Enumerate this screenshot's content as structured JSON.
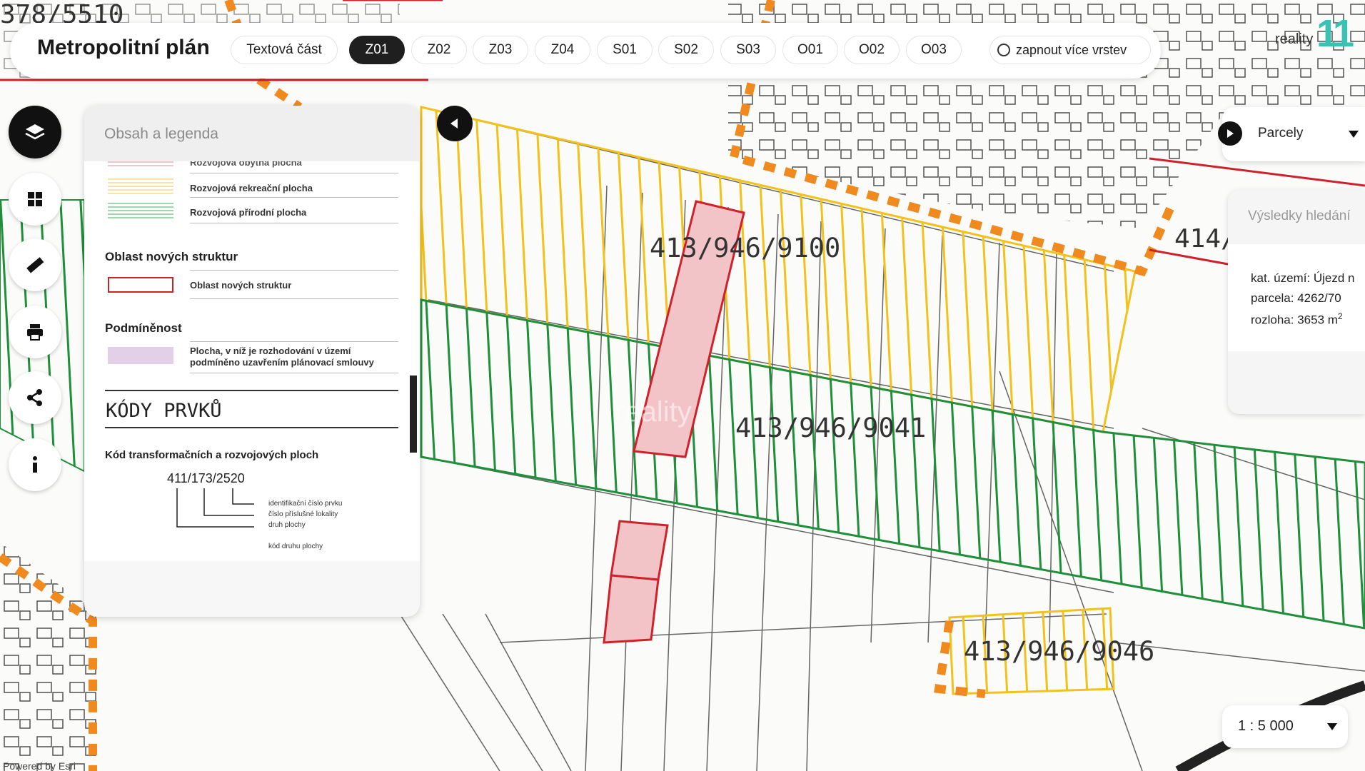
{
  "app": {
    "title": "Metropolitní plán"
  },
  "tabs": [
    {
      "label": "Textová část",
      "active": false
    },
    {
      "label": "Z01",
      "active": true
    },
    {
      "label": "Z02",
      "active": false
    },
    {
      "label": "Z03",
      "active": false
    },
    {
      "label": "Z04",
      "active": false
    },
    {
      "label": "S01",
      "active": false
    },
    {
      "label": "S02",
      "active": false
    },
    {
      "label": "S03",
      "active": false
    },
    {
      "label": "O01",
      "active": false
    },
    {
      "label": "O02",
      "active": false
    },
    {
      "label": "O03",
      "active": false
    }
  ],
  "layers_toggle": {
    "label": "zapnout více vrstev"
  },
  "brand": {
    "text": "reality",
    "mark": "11"
  },
  "tools": [
    "layers-icon",
    "grid-icon",
    "ruler-icon",
    "print-icon",
    "share-icon",
    "info-icon"
  ],
  "legend": {
    "title": "Obsah a legenda",
    "top_cut_item": "Rozvojová obytná plocha",
    "items_top": [
      "Rozvojová rekreační plocha",
      "Rozvojová přírodní plocha"
    ],
    "section_nove": "Oblast nových struktur",
    "item_nove": "Oblast nových struktur",
    "section_podm": "Podmíněnost",
    "item_podm_1": "Plocha, v níž je rozhodování v území",
    "item_podm_2": "podmíněno uzavřením plánovací smlouvy",
    "heading_kody": "KÓDY PRVKŮ",
    "kod_section": "Kód transformačních a rozvojových ploch",
    "kod_example": "411/173/2520",
    "kod_desc": [
      "identifikační číslo prvku",
      "číslo příslušné lokality",
      "druh plochy",
      "kód druhu plochy"
    ]
  },
  "right_panel": {
    "dropdown": "Parcely",
    "results_title": "Výsledky hledání",
    "kat": "kat. území: Újezd n",
    "parcela": "parcela: 4262/70",
    "rozloha": "rozloha: 3653 m",
    "rozloha_sup": "2"
  },
  "map_labels": {
    "l1": "413/946/9100",
    "l2": "413/946/9041",
    "l3": "413/946/9046",
    "l4": "414/",
    "corner_top": "378/5510",
    "watermark": "reality"
  },
  "scale": {
    "value": "1 : 5 000"
  },
  "attribution": "Powered by Esri",
  "colors": {
    "yellow": "#f2c21b",
    "green": "#1f8f3a",
    "red": "#d0212a",
    "orange": "#f08a1e",
    "dark": "#1f1f1f"
  }
}
